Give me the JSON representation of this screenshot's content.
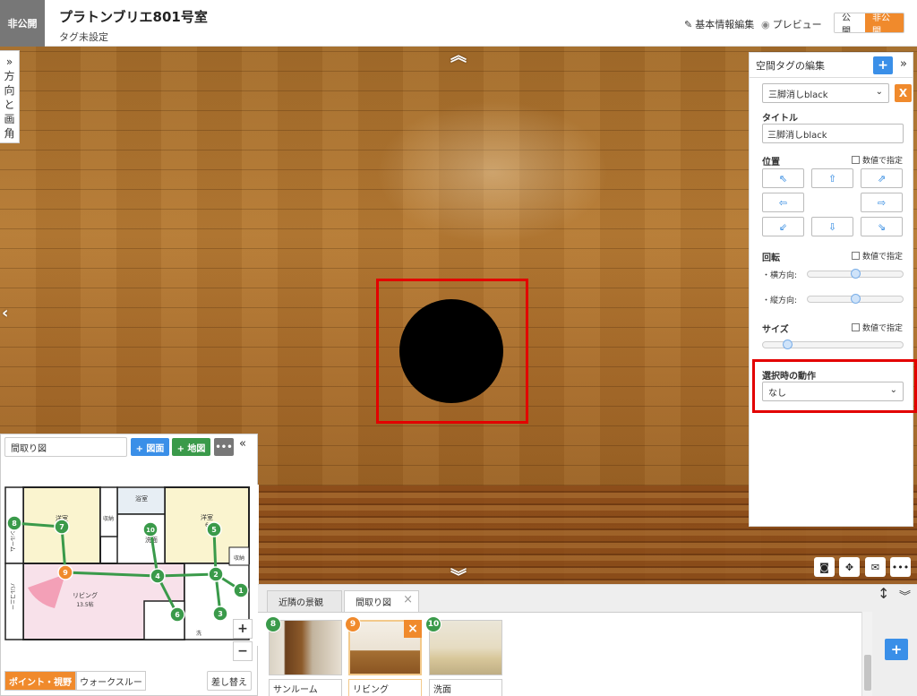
{
  "header": {
    "status": "非公開",
    "title": "プラトンブリエ801号室",
    "tag_status": "タグ未設定",
    "edit_basic_label": "基本情報編集",
    "preview_label": "プレビュー",
    "public_label": "公開",
    "private_label": "非公開"
  },
  "viewer": {
    "side_tab_chars": [
      "»",
      "方",
      "向",
      "と",
      "画",
      "角"
    ]
  },
  "edit_panel": {
    "title": "空間タグの編集",
    "add_label": "+",
    "selected_tag": "三脚消しblack",
    "delete_label": "X",
    "title_label": "タイトル",
    "title_value": "三脚消しblack",
    "position_label": "位置",
    "numeric_spec_label": "数値で指定",
    "rotation_label": "回転",
    "horizontal_label": "・横方向:",
    "vertical_label": "・縦方向:",
    "horizontal_value": 0.5,
    "vertical_value": 0.5,
    "size_label": "サイズ",
    "size_value": 0.15,
    "action_label": "選択時の動作",
    "action_value": "なし"
  },
  "floorplan": {
    "name_value": "間取り図",
    "add_plan_label": "+ 図面",
    "add_map_label": "+ 地図",
    "more_label": "•••",
    "mode_point": "ポイント・視野",
    "mode_walk": "ウォークスルー",
    "swap_label": "差し替え",
    "zoom_in": "+",
    "zoom_out": "−",
    "rooms": {
      "bath": "浴室",
      "washroom": "洗面",
      "storage": "収納",
      "western": "洋室",
      "sunroom": "サンルーム",
      "balcony": "バルコニー",
      "living": "リビング",
      "living_area": "13.5帖",
      "western_size": "6",
      "room_mid": "洋室",
      "sw": "洗",
      "kitchen": "収納"
    },
    "points": [
      "1",
      "2",
      "3",
      "4",
      "5",
      "6",
      "7",
      "8",
      "9",
      "10"
    ]
  },
  "thumbnails": {
    "tab1": "近隣の景観",
    "tab2": "間取り図",
    "items": [
      {
        "num": "8",
        "label": "サンルーム",
        "color": "#3a9a4a"
      },
      {
        "num": "9",
        "label": "リビング",
        "color": "#f08a2c"
      },
      {
        "num": "10",
        "label": "洗面",
        "color": "#3a9a4a"
      }
    ],
    "add_label": "+"
  }
}
